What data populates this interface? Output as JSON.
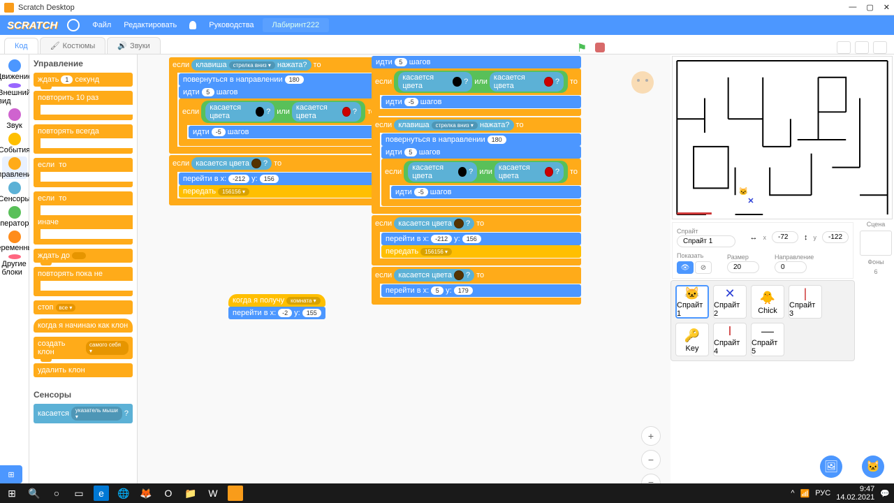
{
  "titlebar": {
    "title": "Scratch Desktop",
    "min": "—",
    "max": "▢",
    "close": "✕"
  },
  "menubar": {
    "logo": "SCRATCH",
    "file": "Файл",
    "edit": "Редактировать",
    "tutorials": "Руководства",
    "project": "Лабиринт222"
  },
  "tabs": {
    "code": "Код",
    "costumes": "Костюмы",
    "sounds": "Звуки"
  },
  "categories": [
    {
      "name": "Движение",
      "color": "#4c97ff"
    },
    {
      "name": "Внешний вид",
      "color": "#9966ff"
    },
    {
      "name": "Звук",
      "color": "#cf63cf"
    },
    {
      "name": "События",
      "color": "#ffbf00"
    },
    {
      "name": "Управление",
      "color": "#ffab19"
    },
    {
      "name": "Сенсоры",
      "color": "#5cb1d6"
    },
    {
      "name": "Операторы",
      "color": "#59c059"
    },
    {
      "name": "Переменные",
      "color": "#ff8c1a"
    },
    {
      "name": "Другие блоки",
      "color": "#ff6680"
    }
  ],
  "palette_header": "Управление",
  "palette_blocks": {
    "wait": "ждать",
    "wait_n": "1",
    "secs": "секунд",
    "repeat": "повторить",
    "repeat_n": "10",
    "times": "раз",
    "forever": "повторять всегда",
    "if": "если",
    "then": "то",
    "else": "иначе",
    "wait_until": "ждать до",
    "repeat_until": "повторять пока не",
    "stop": "стоп",
    "stop_all": "все ▾",
    "when_clone": "когда я начинаю как клон",
    "create_clone": "создать клон",
    "myself": "самого себя ▾",
    "delete_clone": "удалить клон"
  },
  "sensors_header": "Сенсоры",
  "sensors": {
    "touching": "касается",
    "mouse_ptr": "указатель мыши ▾",
    "q": "?"
  },
  "scripts": {
    "key_pressed": "клавиша",
    "arrow_down": "стрелка вниз ▾",
    "pressed": "нажата?",
    "if": "если",
    "then": "то",
    "or": "или",
    "move": "идти",
    "steps": "шагов",
    "step5": "5",
    "stepn5": "-5",
    "turn_dir": "повернуться в направлении",
    "dir180": "180",
    "touch_color": "касается цвета",
    "q": "?",
    "goto_xy": "перейти в x:",
    "y": "y:",
    "x212": "-212",
    "y156": "156",
    "x5": "5",
    "y179": "179",
    "broadcast": "передать",
    "msg": "156156 ▾",
    "when_receive": "когда я получу",
    "room": "комната ▾",
    "xn2": "-2",
    "y155": "155"
  },
  "sprite_info": {
    "label": "Спрайт",
    "name": "Спрайт 1",
    "x_lbl": "x",
    "x": "-72",
    "y_lbl": "y",
    "y": "-122",
    "show": "Показать",
    "size_lbl": "Размер",
    "size": "20",
    "dir_lbl": "Направление",
    "dir": "0"
  },
  "stage_panel": {
    "scene": "Сцена",
    "backdrops": "Фоны",
    "count": "6"
  },
  "sprites": [
    {
      "name": "Спрайт 1",
      "glyph": "🐱",
      "sel": true
    },
    {
      "name": "Спрайт 2",
      "glyph": "✕",
      "color": "#2b3fd6"
    },
    {
      "name": "Chick",
      "glyph": "🐥"
    },
    {
      "name": "Спрайт 3",
      "glyph": "|",
      "color": "#c33"
    },
    {
      "name": "Key",
      "glyph": "🔑"
    },
    {
      "name": "Спрайт 4",
      "glyph": "I",
      "color": "#c33"
    },
    {
      "name": "Спрайт 5",
      "glyph": "—"
    }
  ],
  "taskbar": {
    "lang": "РУС",
    "time": "9:47",
    "date": "14.02.2021"
  }
}
